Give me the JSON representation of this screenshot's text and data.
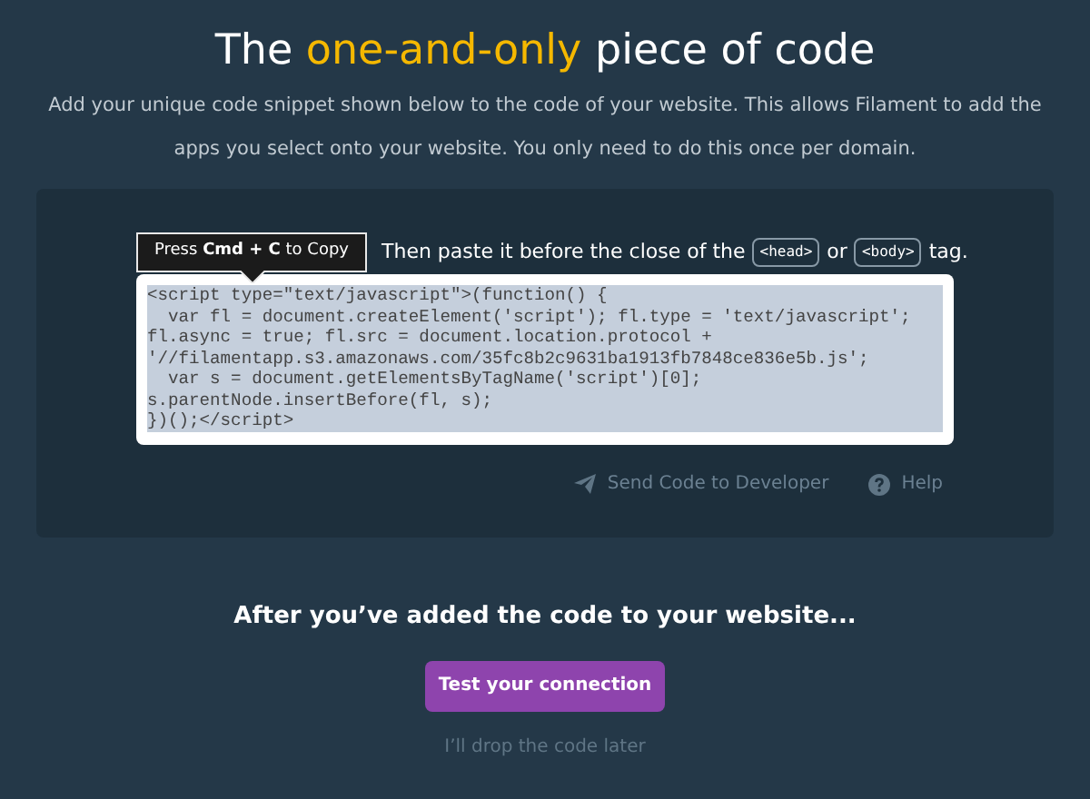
{
  "title": {
    "before": "The ",
    "highlight": "one-and-only",
    "after": " piece of code"
  },
  "intro": "Add your unique code snippet shown below to the code of your website. This allows Filament to add the apps you select onto your website. You only need to do this once per domain.",
  "copy_tooltip": "Press **Cmd + C** to Copy",
  "instruction": [
    {
      "kind": "text",
      "text": "Then paste it before the close of the"
    },
    {
      "kind": "tag",
      "text": "<head>"
    },
    {
      "kind": "text",
      "text": "or"
    },
    {
      "kind": "tag",
      "text": "<body>"
    },
    {
      "kind": "text",
      "text": "tag."
    }
  ],
  "code_lines": [
    "<script type=\"text/javascript\">(function() {",
    "  var fl = document.createElement('script'); fl.type = 'text/javascript';",
    "fl.async = true; fl.src = document.location.protocol +",
    "'//filamentapp.s3.amazonaws.com/35fc8b2c9631ba1913fb7848ce836e5b.js';",
    "  var s = document.getElementsByTagName('script')[0];",
    "s.parentNode.insertBefore(fl, s);",
    "})();</script>"
  ],
  "code_selected": true,
  "links": [
    {
      "kind": "send",
      "label": "Send Code to Developer"
    },
    {
      "kind": "help",
      "label": "Help"
    }
  ],
  "after_heading": "After you’ve added the code to your website...",
  "test_button": "Test your connection",
  "later_link": "I’ll drop the code later"
}
